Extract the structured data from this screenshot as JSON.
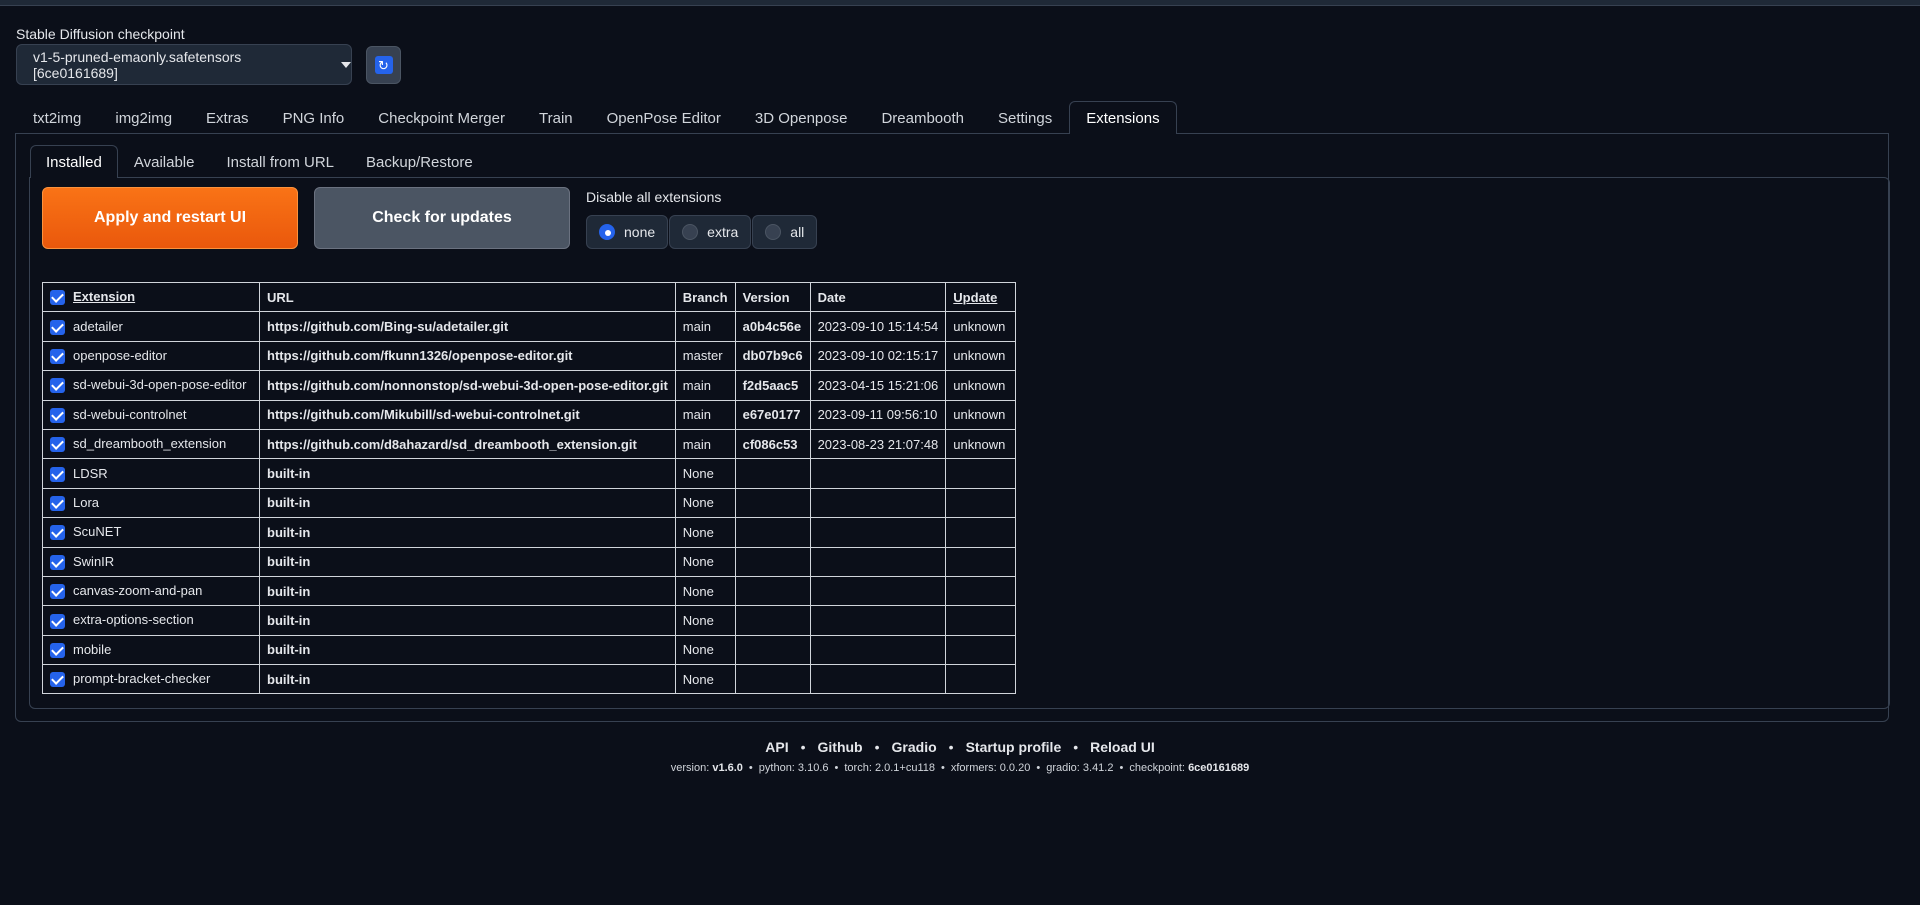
{
  "checkpoint": {
    "label": "Stable Diffusion checkpoint",
    "value": "v1-5-pruned-emaonly.safetensors [6ce0161689]"
  },
  "main_tabs": [
    "txt2img",
    "img2img",
    "Extras",
    "PNG Info",
    "Checkpoint Merger",
    "Train",
    "OpenPose Editor",
    "3D Openpose",
    "Dreambooth",
    "Settings",
    "Extensions"
  ],
  "sub_tabs": [
    "Installed",
    "Available",
    "Install from URL",
    "Backup/Restore"
  ],
  "buttons": {
    "apply": "Apply and restart UI",
    "check": "Check for updates"
  },
  "disable": {
    "label": "Disable all extensions",
    "options": [
      "none",
      "extra",
      "all"
    ],
    "selected": "none"
  },
  "table": {
    "headers": [
      "Extension",
      "URL",
      "Branch",
      "Version",
      "Date",
      "Update"
    ],
    "rows": [
      {
        "name": "adetailer",
        "url": "https://github.com/Bing-su/adetailer.git",
        "branch": "main",
        "version": "a0b4c56e",
        "date": "2023-09-10 15:14:54",
        "update": "unknown"
      },
      {
        "name": "openpose-editor",
        "url": "https://github.com/fkunn1326/openpose-editor.git",
        "branch": "master",
        "version": "db07b9c6",
        "date": "2023-09-10 02:15:17",
        "update": "unknown"
      },
      {
        "name": "sd-webui-3d-open-pose-editor",
        "url": "https://github.com/nonnonstop/sd-webui-3d-open-pose-editor.git",
        "branch": "main",
        "version": "f2d5aac5",
        "date": "2023-04-15 15:21:06",
        "update": "unknown"
      },
      {
        "name": "sd-webui-controlnet",
        "url": "https://github.com/Mikubill/sd-webui-controlnet.git",
        "branch": "main",
        "version": "e67e0177",
        "date": "2023-09-11 09:56:10",
        "update": "unknown"
      },
      {
        "name": "sd_dreambooth_extension",
        "url": "https://github.com/d8ahazard/sd_dreambooth_extension.git",
        "branch": "main",
        "version": "cf086c53",
        "date": "2023-08-23 21:07:48",
        "update": "unknown"
      },
      {
        "name": "LDSR",
        "url": "built-in",
        "branch": "None",
        "version": "",
        "date": "",
        "update": ""
      },
      {
        "name": "Lora",
        "url": "built-in",
        "branch": "None",
        "version": "",
        "date": "",
        "update": ""
      },
      {
        "name": "ScuNET",
        "url": "built-in",
        "branch": "None",
        "version": "",
        "date": "",
        "update": ""
      },
      {
        "name": "SwinIR",
        "url": "built-in",
        "branch": "None",
        "version": "",
        "date": "",
        "update": ""
      },
      {
        "name": "canvas-zoom-and-pan",
        "url": "built-in",
        "branch": "None",
        "version": "",
        "date": "",
        "update": ""
      },
      {
        "name": "extra-options-section",
        "url": "built-in",
        "branch": "None",
        "version": "",
        "date": "",
        "update": ""
      },
      {
        "name": "mobile",
        "url": "built-in",
        "branch": "None",
        "version": "",
        "date": "",
        "update": ""
      },
      {
        "name": "prompt-bracket-checker",
        "url": "built-in",
        "branch": "None",
        "version": "",
        "date": "",
        "update": ""
      }
    ]
  },
  "footer": {
    "links": [
      "API",
      "Github",
      "Gradio",
      "Startup profile",
      "Reload UI"
    ],
    "version_label": "version:",
    "version": "v1.6.0",
    "python": "python: 3.10.6",
    "torch": "torch: 2.0.1+cu118",
    "xformers": "xformers: 0.0.20",
    "gradio": "gradio: 3.41.2",
    "checkpoint_label": "checkpoint:",
    "checkpoint": "6ce0161689"
  },
  "colors": {
    "background": "#0b0f19",
    "accent_orange": "#f97316",
    "accent_blue": "#2563eb"
  },
  "icons": {
    "refresh": "refresh-icon",
    "dropdown": "chevron-down-icon",
    "checkbox": "checkbox-checked-icon"
  }
}
